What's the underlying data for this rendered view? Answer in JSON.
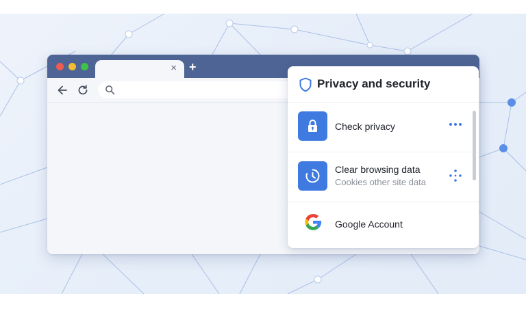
{
  "browser": {
    "tab_close": "×",
    "new_tab": "+"
  },
  "panel": {
    "title": "Privacy and security",
    "items": [
      {
        "label": "Check privacy",
        "icon": "lock-icon"
      },
      {
        "label": "Clear browsing data",
        "sublabel": "Cookies other site data",
        "icon": "clock-icon"
      },
      {
        "label": "Google Account",
        "icon": "google-logo-icon"
      }
    ]
  },
  "colors": {
    "titlebar": "#4d6494",
    "accent": "#3f7ae0",
    "background": "#e6eef9"
  }
}
